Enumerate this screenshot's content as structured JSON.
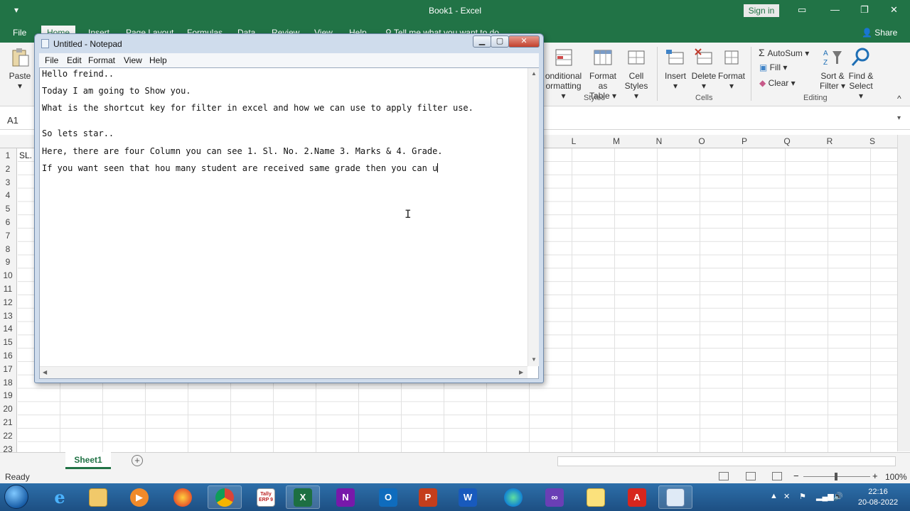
{
  "excel": {
    "window_title": "Book1 - Excel",
    "sign_in": "Sign in",
    "qat_icon": "quick-access-toolbar-icon",
    "tabs": [
      "File",
      "Home",
      "Insert",
      "Page Layout",
      "Formulas",
      "Data",
      "Review",
      "View",
      "Help"
    ],
    "tell_me": "Tell me what you want to do",
    "share": "Share",
    "ribbon": {
      "paste": "Paste",
      "conditional_formatting_1": "onditional",
      "conditional_formatting_2": "ormatting",
      "format_as_table_1": "Format as",
      "format_as_table_2": "Table",
      "cell_styles_1": "Cell",
      "cell_styles_2": "Styles",
      "styles_group": "Styles",
      "insert": "Insert",
      "delete": "Delete",
      "format": "Format",
      "cells_group": "Cells",
      "autosum": "AutoSum",
      "fill": "Fill",
      "clear": "Clear",
      "sort_filter_1": "Sort &",
      "sort_filter_2": "Filter",
      "find_select_1": "Find &",
      "find_select_2": "Select",
      "editing_group": "Editing"
    },
    "name_box": "A1",
    "columns": [
      "L",
      "M",
      "N",
      "O",
      "P",
      "Q",
      "R",
      "S"
    ],
    "rows": [
      "1",
      "2",
      "3",
      "4",
      "5",
      "6",
      "7",
      "8",
      "9",
      "10",
      "11",
      "12",
      "13",
      "14",
      "15",
      "16",
      "17",
      "18",
      "19",
      "20",
      "21",
      "22",
      "23"
    ],
    "cell_a1": "SL.",
    "sheet_tab": "Sheet1",
    "status": "Ready",
    "zoom": "100%"
  },
  "notepad": {
    "title": "Untitled - Notepad",
    "menu": [
      "File",
      "Edit",
      "Format",
      "View",
      "Help"
    ],
    "lines": [
      "Hello freind..",
      "Today I am going to Show you.",
      "What is the shortcut key for filter in excel and how we can use to apply filter use.",
      "So lets star..",
      "Here, there are four Column you can see 1. Sl. No. 2.Name 3. Marks & 4. Grade.",
      "If you want seen that hou many student are received same grade then you can u"
    ]
  },
  "taskbar": {
    "items": [
      "internet-explorer",
      "file-explorer",
      "media-player",
      "firefox",
      "chrome",
      "tally-erp",
      "excel",
      "onenote",
      "outlook",
      "powerpoint",
      "word",
      "edge",
      "visual-studio",
      "sticky-notes",
      "acrobat",
      "notepad"
    ],
    "glyphs": {
      "excel": "X",
      "onenote": "N",
      "outlook": "O",
      "powerpoint": "P",
      "word": "W",
      "acrobat": "A",
      "tally": "Tally ERP 9",
      "ie": "e"
    },
    "time": "22:16",
    "date": "20-08-2022"
  },
  "colors": {
    "excel_green": "#217346",
    "taskbar_blue": "#1d4f83"
  }
}
